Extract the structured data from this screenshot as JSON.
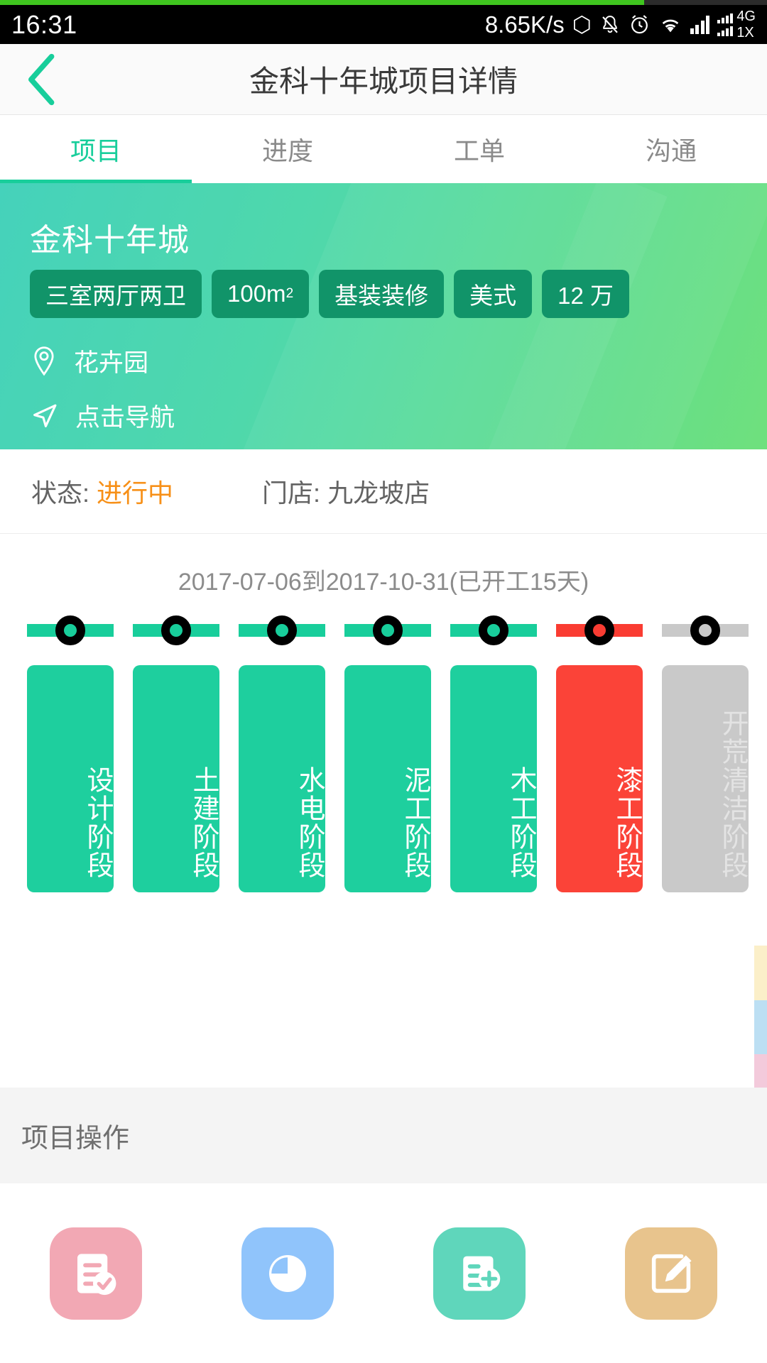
{
  "statusbar": {
    "time": "16:31",
    "network_speed": "8.65K/s",
    "icons": [
      "bluetooth-icon",
      "mute-bell-icon",
      "alarm-icon",
      "wifi-icon",
      "signal-icon"
    ],
    "network_primary": "4G",
    "network_secondary": "1X"
  },
  "header": {
    "title": "金科十年城项目详情",
    "back_icon": "back-chevron-icon"
  },
  "tabs": [
    {
      "label": "项目",
      "active": true
    },
    {
      "label": "进度",
      "active": false
    },
    {
      "label": "工单",
      "active": false
    },
    {
      "label": "沟通",
      "active": false
    }
  ],
  "hero": {
    "project_name": "金科十年城",
    "chips": [
      "三室两厅两卫",
      "100m2",
      "基装装修",
      "美式",
      "12 万"
    ],
    "chip_area_value": "100m",
    "chip_area_sup": "2",
    "location": "花卉园",
    "navigate": "点击导航",
    "location_icon": "map-pin-icon",
    "navigate_icon": "navigation-arrow-icon"
  },
  "status_strip": {
    "status_label": "状态:",
    "status_value": "进行中",
    "status_value_color": "#f79018",
    "store_label": "门店:",
    "store_value": "九龙坡店"
  },
  "timeline": {
    "date_range": "2017-07-06到2017-10-31(已开工15天)",
    "start_date": "2017-07-06",
    "end_date": "2017-10-31",
    "days_started": "已开工15天",
    "colors": {
      "done": "#1ecf9e",
      "alert": "#fb4338",
      "todo": "#c9c9c9"
    },
    "stages": [
      {
        "label": "设计阶段",
        "state": "done"
      },
      {
        "label": "土建阶段",
        "state": "done"
      },
      {
        "label": "水电阶段",
        "state": "done"
      },
      {
        "label": "泥工阶段",
        "state": "done"
      },
      {
        "label": "木工阶段",
        "state": "done"
      },
      {
        "label": "漆工阶段",
        "state": "alert"
      },
      {
        "label": "开荒清洁阶段",
        "state": "todo"
      }
    ]
  },
  "operations": {
    "section_title": "项目操作",
    "items": [
      {
        "icon": "document-check-icon",
        "color": "#f2a8b4"
      },
      {
        "icon": "pie-chart-icon",
        "color": "#90c4fb"
      },
      {
        "icon": "document-add-icon",
        "color": "#5fd6bb"
      },
      {
        "icon": "edit-square-icon",
        "color": "#e8c48d"
      }
    ]
  }
}
